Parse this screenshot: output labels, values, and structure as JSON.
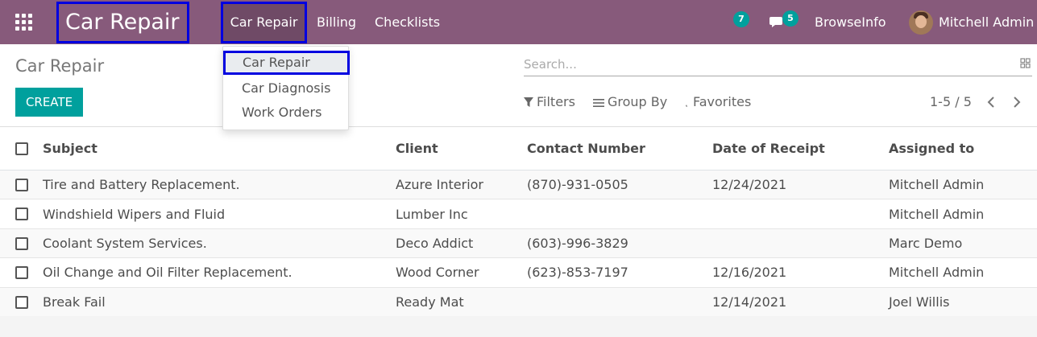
{
  "navbar": {
    "brand": "Car Repair",
    "menu": [
      {
        "label": "Car Repair",
        "active": true
      },
      {
        "label": "Billing"
      },
      {
        "label": "Checklists"
      }
    ],
    "activity_badge": "7",
    "messages_badge": "5",
    "company": "BrowseInfo",
    "user": "Mitchell Admin",
    "color": "#875a7b"
  },
  "dropdown": {
    "items": [
      "Car Repair",
      "Car Diagnosis",
      "Work Orders"
    ],
    "selected": "Car Repair"
  },
  "control_panel": {
    "title": "Car Repair",
    "create_label": "CREATE",
    "search_placeholder": "Search...",
    "filters_label": "Filters",
    "groupby_label": "Group By",
    "favorites_label": "Favorites",
    "pager": "1-5 / 5",
    "accent": "#00a09d"
  },
  "table": {
    "columns": [
      "Subject",
      "Client",
      "Contact Number",
      "Date of Receipt",
      "Assigned to"
    ],
    "rows": [
      {
        "subject": "Tire and Battery Replacement.",
        "client": "Azure Interior",
        "contact": "(870)-931-0505",
        "date": "12/24/2021",
        "assigned": "Mitchell Admin"
      },
      {
        "subject": "Windshield Wipers and Fluid",
        "client": "Lumber Inc",
        "contact": "",
        "date": "",
        "assigned": "Mitchell Admin"
      },
      {
        "subject": "Coolant System Services.",
        "client": "Deco Addict",
        "contact": "(603)-996-3829",
        "date": "",
        "assigned": "Marc Demo"
      },
      {
        "subject": "Oil Change and Oil Filter Replacement.",
        "client": "Wood Corner",
        "contact": "(623)-853-7197",
        "date": "12/16/2021",
        "assigned": "Mitchell Admin"
      },
      {
        "subject": "Break Fail",
        "client": "Ready Mat",
        "contact": "",
        "date": "12/14/2021",
        "assigned": "Joel Willis"
      }
    ]
  }
}
